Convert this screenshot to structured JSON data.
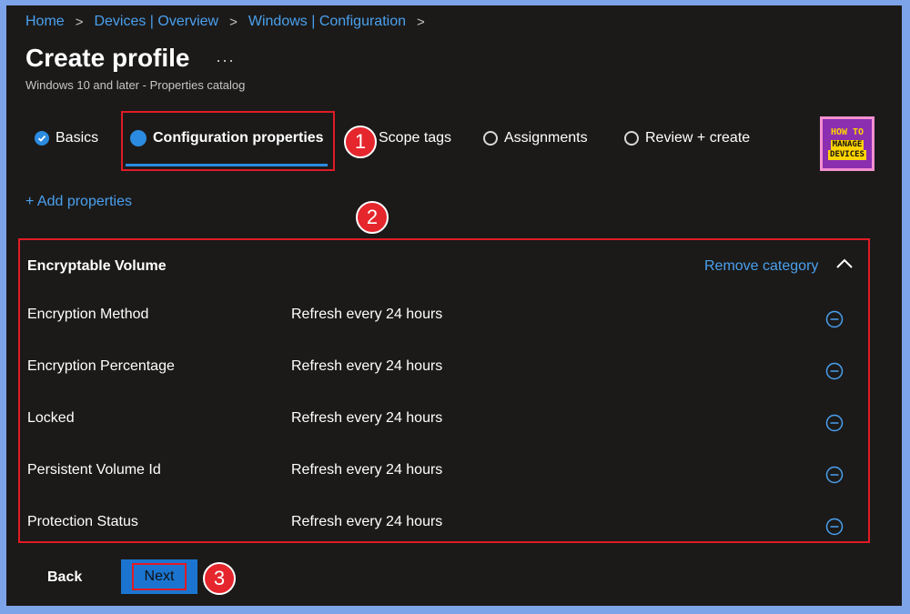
{
  "breadcrumb": {
    "items": [
      "Home",
      "Devices | Overview",
      "Windows | Configuration"
    ],
    "separator": ">"
  },
  "page": {
    "title": "Create profile",
    "more": "···",
    "subtitle": "Windows 10 and later - Properties catalog"
  },
  "tabs": [
    {
      "label": "Basics",
      "state": "done"
    },
    {
      "label": "Configuration properties",
      "state": "active"
    },
    {
      "label": "Scope tags",
      "state": "pending"
    },
    {
      "label": "Assignments",
      "state": "pending"
    },
    {
      "label": "Review + create",
      "state": "pending"
    }
  ],
  "logo": {
    "line1": "HOW TO",
    "line2": "MANAGE",
    "line3": "DEVICES"
  },
  "add_properties": "+ Add properties",
  "category": {
    "title": "Encryptable Volume",
    "remove": "Remove category",
    "rows": [
      {
        "name": "Encryption Method",
        "value": "Refresh every 24 hours"
      },
      {
        "name": "Encryption Percentage",
        "value": "Refresh every 24 hours"
      },
      {
        "name": "Locked",
        "value": "Refresh every 24 hours"
      },
      {
        "name": "Persistent Volume Id",
        "value": "Refresh every 24 hours"
      },
      {
        "name": "Protection Status",
        "value": "Refresh every 24 hours"
      }
    ]
  },
  "footer": {
    "back": "Back",
    "next": "Next"
  },
  "annotations": {
    "step1": "1",
    "step2": "2",
    "step3": "3"
  },
  "colors": {
    "accent": "#2b8be0",
    "link": "#4aa0ee",
    "highlight": "#e01b24",
    "background": "#1b1a19"
  }
}
